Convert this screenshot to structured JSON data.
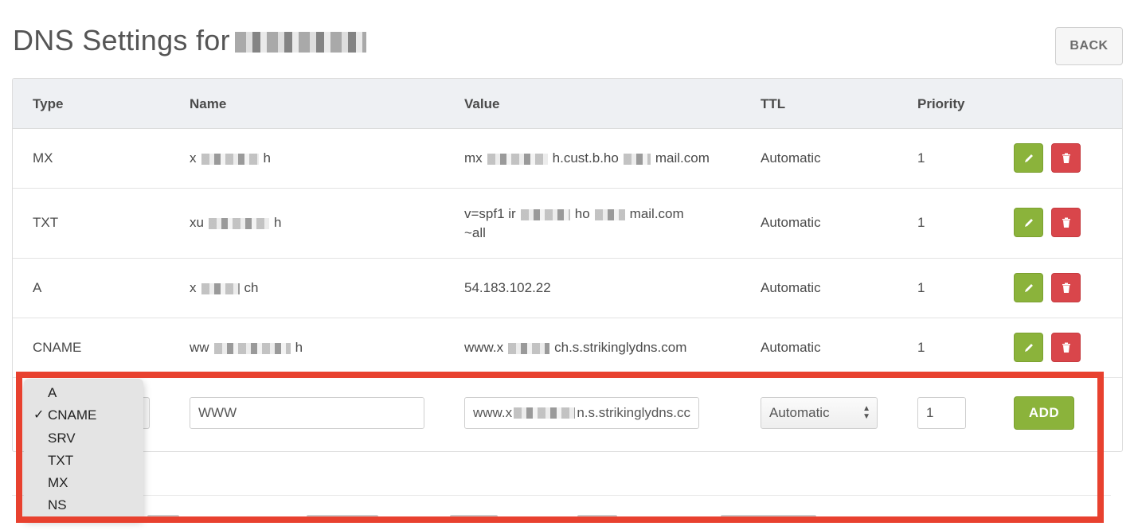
{
  "page": {
    "title": "DNS Settings for",
    "back_label": "BACK"
  },
  "table": {
    "headers": [
      "Type",
      "Name",
      "Value",
      "TTL",
      "Priority"
    ],
    "rows": [
      {
        "type": "MX",
        "name_prefix": "x",
        "name_suffix": "h",
        "value_prefix": "mx",
        "value_suffix": "h.cust.b.ho",
        "value_tail": "mail.com",
        "ttl": "Automatic",
        "priority": "1"
      },
      {
        "type": "TXT",
        "name_prefix": "xu",
        "name_suffix": "h",
        "value_prefix": "v=spf1 ir",
        "value_suffix": "ho",
        "value_tail": "mail.com",
        "value_line2": "~all",
        "ttl": "Automatic",
        "priority": "1"
      },
      {
        "type": "A",
        "name_prefix": "x",
        "name_suffix": "ch",
        "value_prefix": "54.183.102.22",
        "ttl": "Automatic",
        "priority": "1"
      },
      {
        "type": "CNAME",
        "name_prefix": "ww",
        "name_suffix": "h",
        "value_prefix": "www.x",
        "value_suffix": "ch.s.strikinglydns.com",
        "ttl": "Automatic",
        "priority": "1"
      }
    ]
  },
  "new_record": {
    "name_value": "WWW",
    "value_prefix": "www.x",
    "value_suffix": "n.s.strikinglydns.cc",
    "ttl_selected": "Automatic",
    "priority_value": "1",
    "add_label": "ADD"
  },
  "type_dropdown": {
    "options": [
      "A",
      "CNAME",
      "SRV",
      "TXT",
      "MX",
      "NS"
    ],
    "selected": "CNAME",
    "check": "✓"
  },
  "colors": {
    "edit": "#8bb33b",
    "delete": "#d9464b",
    "highlight": "#e8412f",
    "header_bg": "#eef0f3"
  },
  "icons": {
    "edit": "pencil-icon",
    "delete": "trash-icon",
    "ttl_select": "updown-arrows-icon",
    "selected_option": "checkmark-icon"
  }
}
